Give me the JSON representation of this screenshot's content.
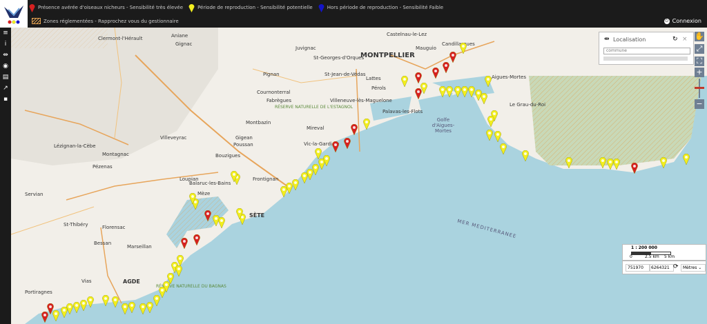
{
  "legend": {
    "item_red": "Présence avérée d'oiseaux nicheurs - Sensibilité très élevée",
    "item_yellow": "Période de reproduction - Sensibilité potentielle",
    "item_blue": "Hors période de reproduction - Sensibilité Faible",
    "item_zone": "Zones réglementées - Rapprochez vous du gestionnaire"
  },
  "auth": {
    "login_label": "Connexion"
  },
  "locate": {
    "title": "Localisation",
    "input_placeholder": "commune"
  },
  "scale": {
    "ratio": "1 : 200 000",
    "tick0": "0",
    "tick1": "2.5 km",
    "tick2": "5 km"
  },
  "coords": {
    "x": "751970",
    "y": "6264321",
    "unit": "Mètres"
  },
  "map_labels": {
    "montpellier": "MONTPELLIER",
    "sete": "SÈTE",
    "agde": "AGDE",
    "golfe": "Golfe d'Aigues-Mortes",
    "mer": "MER MEDITERRANEE",
    "clermont": "Clermont-l'Hérault",
    "pezenas": "Pézenas",
    "frontignan": "Frontignan",
    "aigues_mortes": "Aigues-Mortes",
    "palavas": "Palavas-les-Flots",
    "lattes": "Lattes",
    "perols": "Pérols",
    "balaruc": "Balaruc-les-Bains",
    "meze": "Mèze",
    "marseillan": "Marseillan",
    "vias": "Vias",
    "portiragnes": "Portiragnes",
    "bessan": "Bessan",
    "florensac": "Florensac",
    "grau_du_roi": "Le Grau-du-Roi",
    "reserve_estagnol": "RÉSERVE NATURELLE DE L'ESTAGNOL",
    "reserve_bagnas": "RÉSERVE NATURELLE DU BAGNAS",
    "mauguio": "Mauguio",
    "candillargues": "Candillargues",
    "st_georges": "St-Georges-d'Orques",
    "gigean": "Gigean",
    "poussan": "Poussan",
    "bouzigues": "Bouzigues",
    "loupian": "Loupian",
    "montagnac": "Montagnac",
    "fabregues": "Fabrègues",
    "cournonterral": "Cournonterral",
    "pignan": "Pignan",
    "villeneuve": "Villeneuve-lès-Maguelone",
    "st_jean_vedas": "St-Jean-de-Védas",
    "juvignac": "Juvignac",
    "gignac": "Gignac",
    "aniane": "Aniane",
    "montbazin": "Montbazin",
    "villeveyrac": "Villeveyrac",
    "servian": "Servian",
    "lezignan": "Lézignan-la-Cèbe",
    "st_thibery": "St-Thibéry",
    "castelnau": "Castelnau-le-Lez",
    "vic": "Vic-la-Gardiole",
    "mireval": "Mireval"
  },
  "colors": {
    "red": "#d62020",
    "yellow": "#f2ee1f",
    "blue": "#1414c8",
    "sea": "#aad3df",
    "land": "#f2efe9"
  }
}
